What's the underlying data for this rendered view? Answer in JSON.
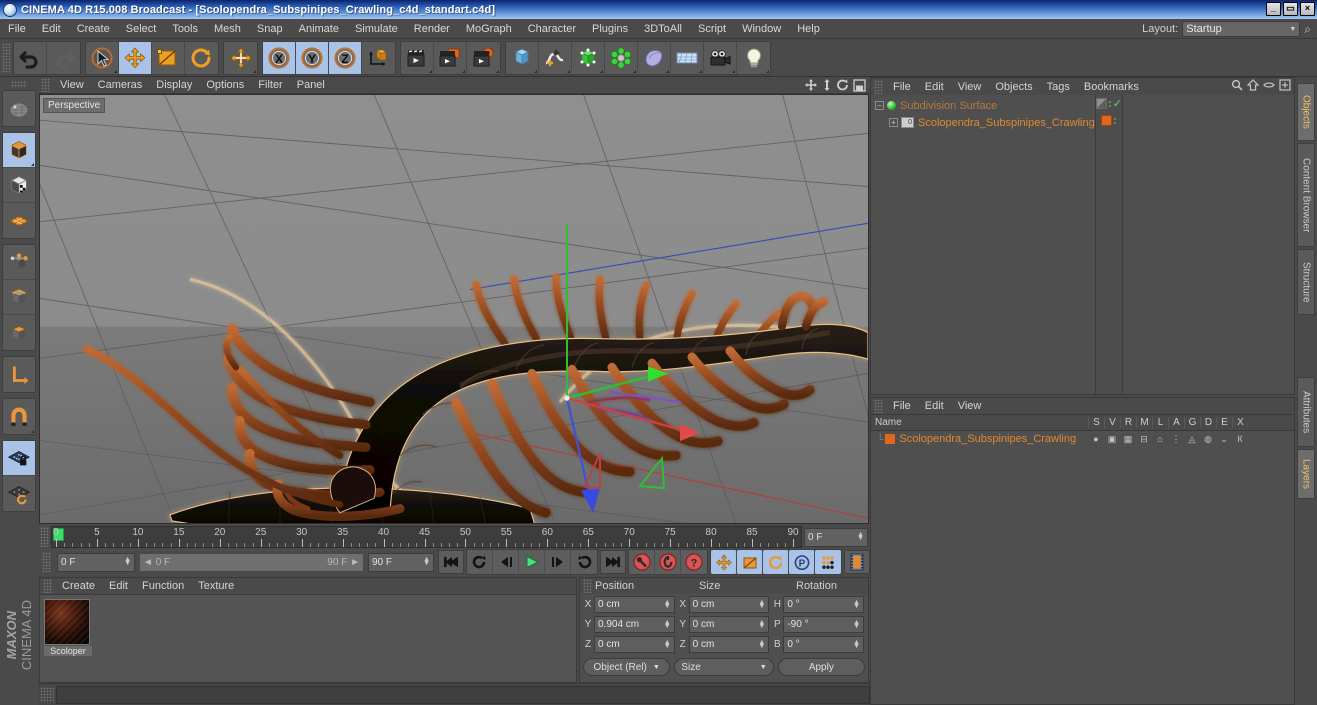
{
  "window": {
    "title": "CINEMA 4D R15.008 Broadcast - [Scolopendra_Subspinipes_Crawling_c4d_standart.c4d]",
    "minimize": "_",
    "maximize": "▭",
    "close": "×"
  },
  "menubar": {
    "items": [
      "File",
      "Edit",
      "Create",
      "Select",
      "Tools",
      "Mesh",
      "Snap",
      "Animate",
      "Simulate",
      "Render",
      "MoGraph",
      "Character",
      "Plugins",
      "3DToAll",
      "Script",
      "Window",
      "Help"
    ],
    "layout_label": "Layout:",
    "layout_value": "Startup",
    "search_icon": "search-icon"
  },
  "toolbar": {
    "groups": [
      {
        "buttons": [
          {
            "name": "undo-button",
            "icon": "undo-icon",
            "state": "enabled"
          },
          {
            "name": "redo-button",
            "icon": "redo-icon",
            "state": "disabled"
          }
        ]
      },
      {
        "buttons": [
          {
            "name": "live-selection-tool",
            "icon": "cursor-select-icon",
            "state": "enabled"
          },
          {
            "name": "move-tool",
            "icon": "move-arrows-icon",
            "state": "selected"
          },
          {
            "name": "scale-tool",
            "icon": "scale-box-icon",
            "state": "enabled"
          },
          {
            "name": "rotate-tool",
            "icon": "rotate-circle-icon",
            "state": "enabled"
          }
        ]
      },
      {
        "buttons": [
          {
            "name": "world-object-axis-tool",
            "icon": "plus-axis-icon",
            "state": "enabled"
          }
        ]
      },
      {
        "buttons": [
          {
            "name": "x-axis-lock",
            "icon": "x-axis-icon",
            "state": "selected"
          },
          {
            "name": "y-axis-lock",
            "icon": "y-axis-icon",
            "state": "selected"
          },
          {
            "name": "z-axis-lock",
            "icon": "z-axis-icon",
            "state": "selected"
          },
          {
            "name": "world-coordinate-system",
            "icon": "world-cube-icon",
            "state": "enabled"
          }
        ]
      },
      {
        "buttons": [
          {
            "name": "render-view-button",
            "icon": "render-clapper-icon",
            "state": "enabled"
          },
          {
            "name": "render-to-picture-viewer-button",
            "icon": "render-picture-icon",
            "state": "enabled"
          },
          {
            "name": "render-settings-button",
            "icon": "render-settings-gear-icon",
            "state": "enabled"
          }
        ]
      },
      {
        "buttons": [
          {
            "name": "add-cube-object",
            "icon": "cube-icon",
            "state": "enabled"
          },
          {
            "name": "add-spline-object",
            "icon": "spline-pen-icon",
            "state": "enabled"
          },
          {
            "name": "add-generator-object",
            "icon": "generator-green-cube-icon",
            "state": "enabled"
          },
          {
            "name": "add-deformer-object",
            "icon": "deformer-green-icon",
            "state": "enabled"
          },
          {
            "name": "add-scene-object",
            "icon": "scene-blob-icon",
            "state": "enabled"
          },
          {
            "name": "add-floor-object",
            "icon": "floor-grid-icon",
            "state": "enabled"
          },
          {
            "name": "add-camera-object",
            "icon": "camera-icon",
            "state": "enabled"
          },
          {
            "name": "add-light-object",
            "icon": "light-bulb-icon",
            "state": "enabled"
          }
        ]
      }
    ]
  },
  "left_toolbar": {
    "groups": [
      {
        "buttons": [
          {
            "name": "make-editable-tool",
            "icon": "make-editable-icon",
            "state": "enabled"
          }
        ]
      },
      {
        "buttons": [
          {
            "name": "model-mode",
            "icon": "model-cube-icon",
            "state": "selected"
          },
          {
            "name": "texture-mode",
            "icon": "texture-checker-cube-icon",
            "state": "enabled"
          },
          {
            "name": "workplane-mode",
            "icon": "workplane-grid-icon",
            "state": "enabled"
          }
        ]
      },
      {
        "buttons": [
          {
            "name": "points-mode",
            "icon": "points-cube-icon",
            "state": "enabled"
          },
          {
            "name": "edges-mode",
            "icon": "edges-cube-icon",
            "state": "enabled"
          },
          {
            "name": "polygons-mode",
            "icon": "polygons-cube-icon",
            "state": "enabled"
          }
        ]
      },
      {
        "buttons": [
          {
            "name": "axis-modify-mode",
            "icon": "axis-l-icon",
            "state": "enabled"
          }
        ]
      },
      {
        "buttons": [
          {
            "name": "enable-snap-tool",
            "icon": "magnet-icon",
            "state": "enabled"
          }
        ]
      },
      {
        "buttons": [
          {
            "name": "workplane-lock",
            "icon": "workplane-lock-icon",
            "state": "selected"
          },
          {
            "name": "workplane-rotate",
            "icon": "workplane-rotate-icon",
            "state": "enabled"
          }
        ]
      }
    ],
    "brand_line1": "MAXON",
    "brand_line2": "CINEMA 4D"
  },
  "viewport": {
    "menus": [
      "View",
      "Cameras",
      "Display",
      "Options",
      "Filter",
      "Panel"
    ],
    "label": "Perspective",
    "nav_icons": [
      "viewport-move-icon",
      "viewport-zoom-icon",
      "viewport-rotate-icon",
      "viewport-maximize-icon"
    ],
    "scene_object": "Scolopendra centipede 3D model"
  },
  "timeline": {
    "ticks": [
      0,
      5,
      10,
      15,
      20,
      25,
      30,
      35,
      40,
      45,
      50,
      55,
      60,
      65,
      70,
      75,
      80,
      85,
      90
    ],
    "current_frame_right": "0 F",
    "current_frame_field": "0 F",
    "range_start": "0 F",
    "range_end": "90 F",
    "end_frame_field": "90 F",
    "playhead_frame": 0,
    "transport": [
      {
        "name": "go-to-start-button",
        "icon": "skip-start-icon"
      },
      {
        "name": "play-backwards-loop-button",
        "icon": "loop-back-icon"
      },
      {
        "name": "previous-frame-button",
        "icon": "step-back-icon"
      },
      {
        "name": "play-button",
        "icon": "play-icon"
      },
      {
        "name": "next-frame-button",
        "icon": "step-forward-icon"
      },
      {
        "name": "play-forwards-loop-button",
        "icon": "loop-forward-icon"
      },
      {
        "name": "go-to-end-button",
        "icon": "skip-end-icon"
      }
    ],
    "record_buttons": [
      {
        "name": "record-active-objects-button",
        "icon": "record-key-icon"
      },
      {
        "name": "autokeying-button",
        "icon": "autokey-circle-icon"
      },
      {
        "name": "keyframe-selection-button",
        "icon": "keyframe-question-icon"
      }
    ],
    "key_toggles": [
      {
        "name": "position-key-toggle",
        "icon": "position-key-icon",
        "state": "selected"
      },
      {
        "name": "scale-key-toggle",
        "icon": "scale-key-icon",
        "state": "selected"
      },
      {
        "name": "rotation-key-toggle",
        "icon": "rotation-key-icon",
        "state": "selected"
      },
      {
        "name": "parameter-key-toggle",
        "icon": "parameter-p-icon",
        "state": "selected"
      },
      {
        "name": "point-level-animation-toggle",
        "icon": "pla-dots-icon",
        "state": "selected"
      }
    ],
    "film_button": {
      "name": "timeline-film-button",
      "icon": "film-strip-icon"
    }
  },
  "material_manager": {
    "menus": [
      "Create",
      "Edit",
      "Function",
      "Texture"
    ],
    "materials": [
      {
        "name": "Scoloper",
        "thumb": "sphere-preview"
      }
    ]
  },
  "coordinates": {
    "headers": [
      "Position",
      "Size",
      "Rotation"
    ],
    "rows": [
      {
        "pos_axis": "X",
        "pos_value": "0 cm",
        "size_axis": "X",
        "size_value": "0 cm",
        "rot_axis": "H",
        "rot_value": "0 °"
      },
      {
        "pos_axis": "Y",
        "pos_value": "0.904 cm",
        "size_axis": "Y",
        "size_value": "0 cm",
        "rot_axis": "P",
        "rot_value": "-90 °"
      },
      {
        "pos_axis": "Z",
        "pos_value": "0 cm",
        "size_axis": "Z",
        "size_value": "0 cm",
        "rot_axis": "B",
        "rot_value": "0 °"
      }
    ],
    "mode_combo": "Object (Rel)",
    "size_combo": "Size",
    "apply_button": "Apply"
  },
  "object_manager": {
    "menus": [
      "File",
      "Edit",
      "View",
      "Objects",
      "Tags",
      "Bookmarks"
    ],
    "header_icons": [
      "search-icon",
      "home-icon",
      "eye-icon",
      "fit-icon"
    ],
    "tree": [
      {
        "name": "Subdivision Surface",
        "type": "generator",
        "indent": 0,
        "selected": false,
        "dimmed": true
      },
      {
        "name": "Scolopendra_Subspinipes_Crawling",
        "type": "polygon",
        "indent": 1,
        "selected": false,
        "dimmed": false
      }
    ]
  },
  "attribute_manager": {
    "menus": [
      "File",
      "Edit",
      "View"
    ],
    "columns": [
      "Name",
      "S",
      "V",
      "R",
      "M",
      "L",
      "A",
      "G",
      "D",
      "E",
      "X"
    ],
    "rows": [
      {
        "name": "Scolopendra_Subspinipes_Crawling",
        "color": "#e2661b"
      }
    ]
  },
  "side_tabs": [
    {
      "label": "Objects",
      "active": true
    },
    {
      "label": "Content Browser",
      "active": false
    },
    {
      "label": "Structure",
      "active": false
    },
    {
      "label": "Attributes",
      "active": false
    },
    {
      "label": "Layers",
      "active": true
    }
  ],
  "colors": {
    "accent_orange": "#e08a2e",
    "selection_blue": "#a9c3e8",
    "panel_bg": "#4a4a4a",
    "titlebar_blue": "#2b5fb8"
  }
}
